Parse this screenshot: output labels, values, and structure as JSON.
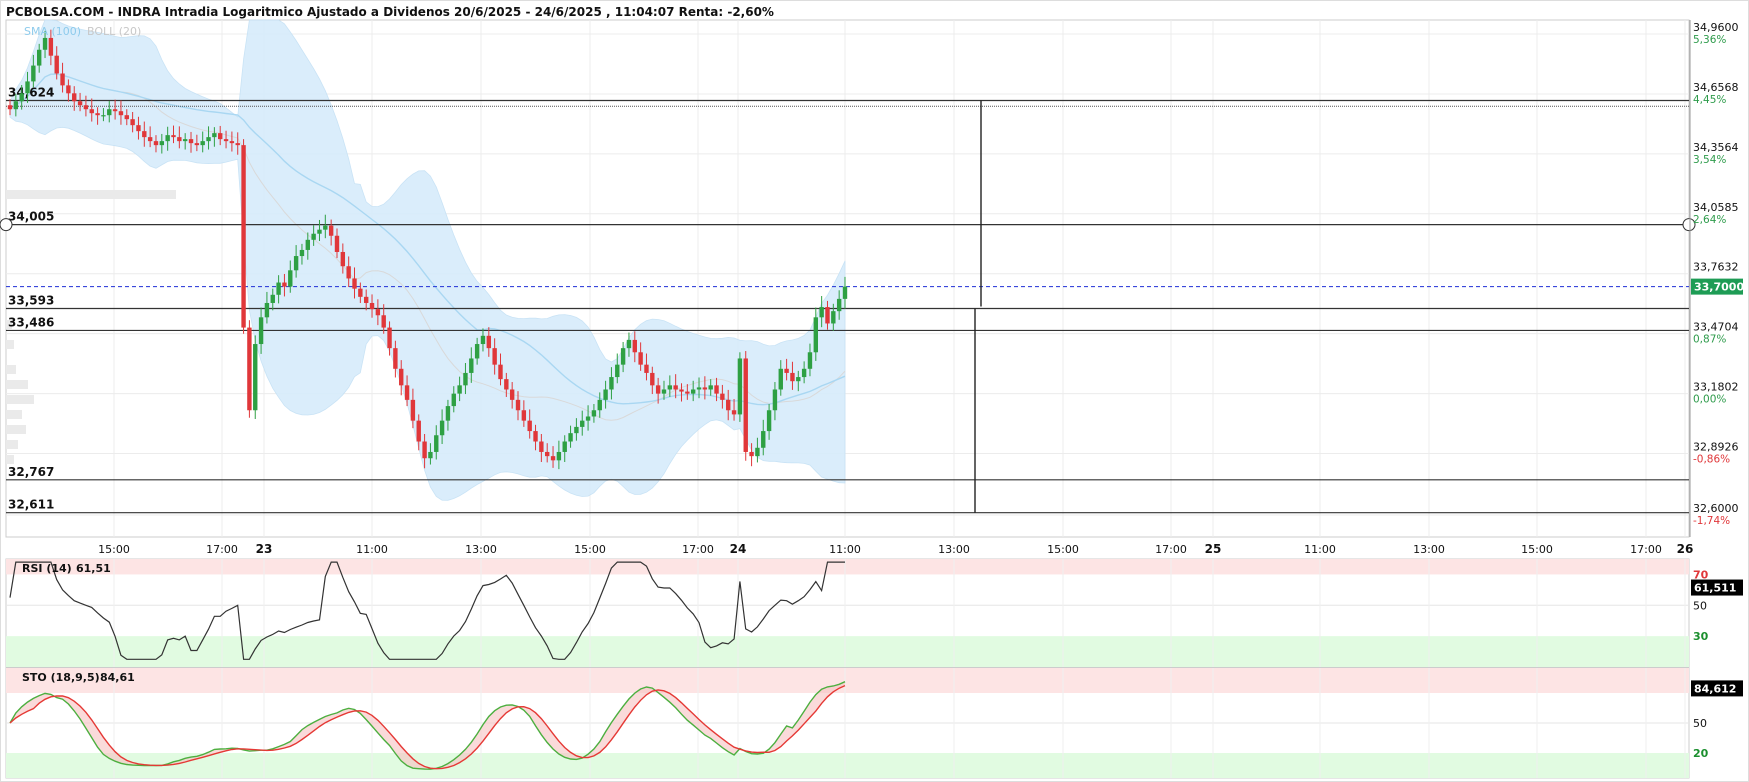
{
  "title": "PCBOLSA.COM - INDRA Intradia Logaritmico Ajustado a Dividenos 20/6/2025 - 24/6/2025 , 11:04:07 Renta: -2,60%",
  "legend": {
    "sma": "SMA (100)",
    "boll": "BOLL (20)"
  },
  "colors": {
    "up": "#2ea043",
    "down": "#e0373a",
    "sma": "#a9d7f2",
    "boll_fill": "#d6ecfb",
    "boll_mid": "#d9d9d9",
    "current": "#1f2fd6",
    "badge": "#1e9c55",
    "rsi_line": "#333333",
    "sto_k": "#4caf3f",
    "sto_d": "#e53935"
  },
  "y_axis": {
    "prices": [
      "34,9600",
      "34,6568",
      "34,3564",
      "34,0585",
      "33,7632",
      "33,4704",
      "33,1802",
      "32,8926",
      "32,6000"
    ],
    "percents": [
      "5,36%",
      "4,45%",
      "3,54%",
      "2,64%",
      "",
      "0,87%",
      "0,00%",
      "-0,86%",
      "-1,74%"
    ],
    "current_label": "33,7000"
  },
  "levels": [
    "34,624",
    "34,005",
    "33,593",
    "33,486",
    "32,767",
    "32,611"
  ],
  "x_axis": {
    "labels": [
      "15:00",
      "17:00",
      "23",
      "11:00",
      "13:00",
      "15:00",
      "17:00",
      "24",
      "11:00",
      "13:00",
      "15:00",
      "17:00",
      "25",
      "11:00",
      "13:00",
      "15:00",
      "17:00",
      "26"
    ]
  },
  "rsi": {
    "label": "RSI (14)",
    "value": "61,51",
    "badge": "61,511",
    "levels": [
      "70",
      "50",
      "30"
    ]
  },
  "sto": {
    "label": "STO (18,9,5)",
    "value": "84,61",
    "badge": "84,612",
    "levels": [
      "50",
      "20"
    ]
  },
  "chart_data": {
    "type": "candlestick",
    "title": "PCBOLSA.COM - INDRA Intradia Logaritmico Ajustado a Dividenos 20/6/2025 - 24/6/2025 , 11:04:07 Renta: -2,60%",
    "ylim": [
      32.6,
      34.96
    ],
    "scale": "log",
    "current_price": 33.7,
    "support_resistance": [
      34.624,
      34.005,
      33.593,
      33.486,
      32.767,
      32.611
    ],
    "series": [
      {
        "name": "Price",
        "close": [
          34.58,
          34.62,
          34.66,
          34.72,
          34.8,
          34.88,
          34.94,
          34.85,
          34.76,
          34.7,
          34.66,
          34.62,
          34.6,
          34.58,
          34.56,
          34.55,
          34.55,
          34.58,
          34.57,
          34.55,
          34.53,
          34.5,
          34.47,
          34.44,
          34.42,
          34.4,
          34.42,
          34.45,
          34.44,
          34.42,
          34.43,
          34.41,
          34.4,
          34.42,
          34.44,
          34.46,
          34.43,
          34.42,
          34.41,
          34.4,
          33.5,
          33.1,
          33.42,
          33.55,
          33.62,
          33.66,
          33.72,
          33.7,
          33.78,
          33.85,
          33.88,
          33.93,
          33.96,
          33.98,
          34.0,
          33.95,
          33.87,
          33.8,
          33.74,
          33.69,
          33.65,
          33.62,
          33.59,
          33.56,
          33.5,
          33.4,
          33.3,
          33.22,
          33.15,
          33.05,
          32.95,
          32.87,
          32.9,
          32.98,
          33.05,
          33.12,
          33.18,
          33.22,
          33.28,
          33.35,
          33.42,
          33.46,
          33.4,
          33.32,
          33.25,
          33.2,
          33.15,
          33.1,
          33.05,
          33.0,
          32.95,
          32.9,
          32.88,
          32.86,
          32.9,
          32.95,
          32.99,
          33.02,
          33.05,
          33.07,
          33.1,
          33.15,
          33.2,
          33.26,
          33.32,
          33.4,
          33.44,
          33.38,
          33.32,
          33.28,
          33.22,
          33.18,
          33.2,
          33.22,
          33.2,
          33.19,
          33.18,
          33.2,
          33.21,
          33.2,
          33.22,
          33.18,
          33.15,
          33.1,
          33.08,
          33.35,
          32.9,
          32.88,
          32.92,
          33.0,
          33.1,
          33.2,
          33.3,
          33.28,
          33.24,
          33.26,
          33.3,
          33.38,
          33.55,
          33.6,
          33.52,
          33.58,
          33.64,
          33.7
        ]
      }
    ],
    "indicators": {
      "sma_100": "overlay",
      "bollinger_20": "overlay",
      "rsi_14": {
        "last": 61.51,
        "levels": [
          70,
          50,
          30
        ]
      },
      "stochastic_18_9_5": {
        "last": 84.61,
        "levels": [
          80,
          50,
          20
        ]
      }
    }
  }
}
